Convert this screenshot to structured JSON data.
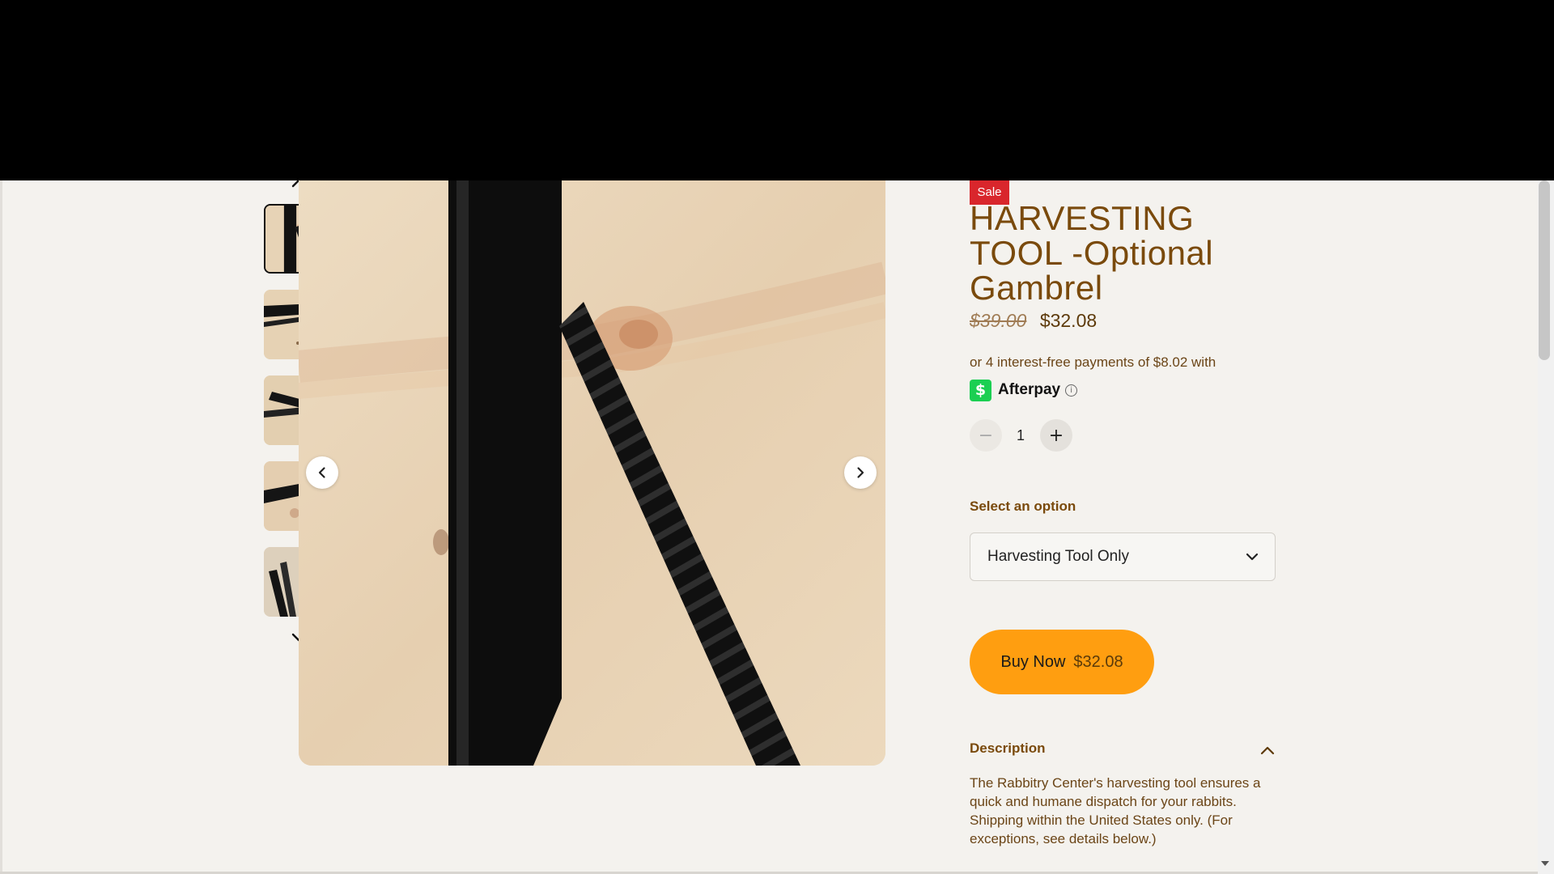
{
  "product": {
    "badge": "Sale",
    "title": "HARVESTING TOOL -Optional Gambrel",
    "old_price": "$39.00",
    "price": "$32.08"
  },
  "afterpay": {
    "text": "or 4 interest-free payments of $8.02 with",
    "logo_glyph": "$",
    "name": "Afterpay",
    "info_glyph": "i"
  },
  "quantity": {
    "minus": "−",
    "value": "1",
    "plus": "+"
  },
  "option": {
    "label": "Select an option",
    "selected": "Harvesting Tool Only"
  },
  "buy": {
    "label": "Buy Now",
    "price": "$32.08"
  },
  "description": {
    "header": "Description",
    "text": "The Rabbitry Center's harvesting tool ensures a quick and humane dispatch for your rabbits. Shipping within the United States only. (For exceptions, see details below.)"
  },
  "gallery": {
    "thumbnail_count": 5,
    "active_index": 0
  },
  "colors": {
    "accent_brown": "#7a4a0c",
    "sale_red": "#d9262c",
    "buy_orange": "#ff9e10",
    "afterpay_green": "#1bcf52"
  }
}
